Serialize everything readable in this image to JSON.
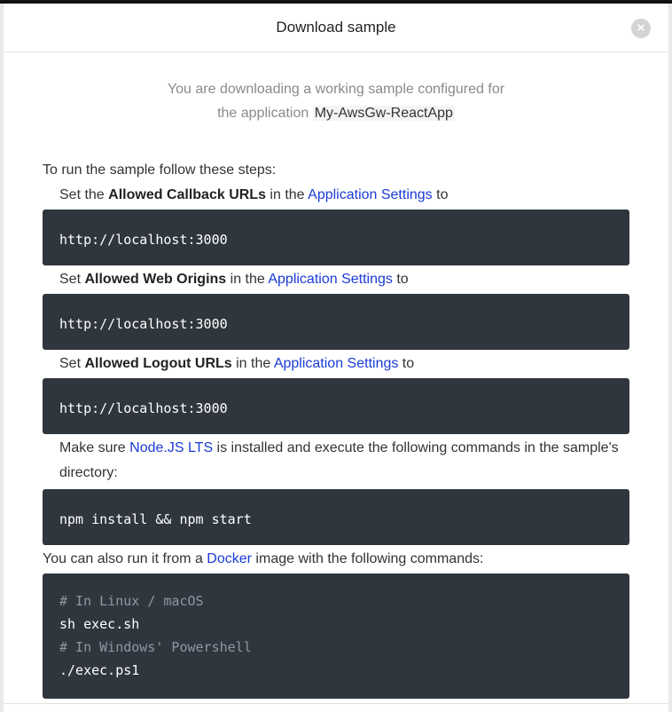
{
  "modal": {
    "title": "Download sample",
    "close_label": "×"
  },
  "intro": {
    "line1": "You are downloading a working sample configured for",
    "line2_prefix": "the application ",
    "app_name": "My-AwsGw-ReactApp"
  },
  "lead": "To run the sample follow these steps:",
  "steps": [
    {
      "pre": "Set the ",
      "bold": "Allowed Callback URLs",
      "mid": " in the ",
      "link": "Application Settings",
      "post": " to",
      "code": "http://localhost:3000"
    },
    {
      "pre": "Set ",
      "bold": "Allowed Web Origins",
      "mid": " in the ",
      "link": "Application Settings",
      "post": " to",
      "code": "http://localhost:3000"
    },
    {
      "pre": "Set ",
      "bold": "Allowed Logout URLs",
      "mid": " in the ",
      "link": "Application Settings",
      "post": " to",
      "code": "http://localhost:3000"
    }
  ],
  "node": {
    "pre": "Make sure ",
    "link": "Node.JS LTS",
    "post": " is installed and execute the following commands in the sample's directory:",
    "code": "npm install && npm start"
  },
  "docker": {
    "pre": "You can also run it from a ",
    "link": "Docker",
    "post": " image with the following commands:",
    "lines": [
      "# In Linux / macOS",
      "sh exec.sh",
      "# In Windows' Powershell",
      "./exec.ps1"
    ]
  }
}
